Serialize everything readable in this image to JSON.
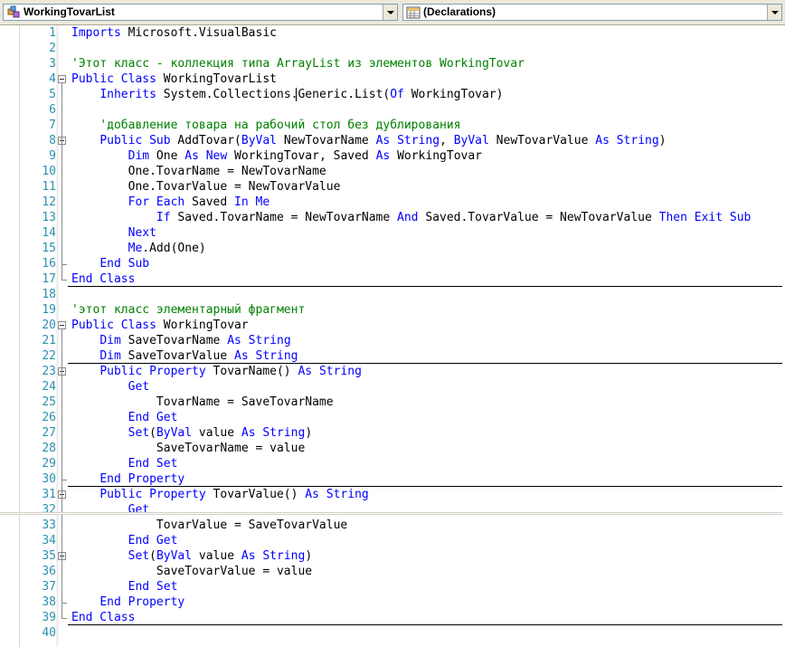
{
  "navigation": {
    "class_selector": "WorkingTovarList",
    "member_selector": "(Declarations)"
  },
  "code": {
    "lines": [
      {
        "n": "1",
        "tokens": [
          {
            "t": "Imports",
            "c": "kw"
          },
          {
            "t": " Microsoft.VisualBasic"
          }
        ]
      },
      {
        "n": "2",
        "tokens": []
      },
      {
        "n": "3",
        "tokens": [
          {
            "t": "'Этот класс - коллекция типа ArrayList из элементов WorkingTovar",
            "c": "cm"
          }
        ]
      },
      {
        "n": "4",
        "tokens": [
          {
            "t": "Public Class",
            "c": "kw"
          },
          {
            "t": " WorkingTovarList"
          }
        ]
      },
      {
        "n": "5",
        "tokens": [
          {
            "t": "    "
          },
          {
            "t": "Inherits",
            "c": "kw"
          },
          {
            "t": " System.Collections.Generic.List("
          },
          {
            "t": "Of",
            "c": "kw"
          },
          {
            "t": " WorkingTovar)"
          }
        ]
      },
      {
        "n": "6",
        "tokens": []
      },
      {
        "n": "7",
        "tokens": [
          {
            "t": "    "
          },
          {
            "t": "'добавление товара на рабочий стол без дублирования",
            "c": "cm"
          }
        ]
      },
      {
        "n": "8",
        "tokens": [
          {
            "t": "    "
          },
          {
            "t": "Public Sub",
            "c": "kw"
          },
          {
            "t": " AddTovar("
          },
          {
            "t": "ByVal",
            "c": "kw"
          },
          {
            "t": " NewTovarName "
          },
          {
            "t": "As String",
            "c": "kw"
          },
          {
            "t": ", "
          },
          {
            "t": "ByVal",
            "c": "kw"
          },
          {
            "t": " NewTovarValue "
          },
          {
            "t": "As String",
            "c": "kw"
          },
          {
            "t": ")"
          }
        ]
      },
      {
        "n": "9",
        "tokens": [
          {
            "t": "        "
          },
          {
            "t": "Dim",
            "c": "kw"
          },
          {
            "t": " One "
          },
          {
            "t": "As New",
            "c": "kw"
          },
          {
            "t": " WorkingTovar, Saved "
          },
          {
            "t": "As",
            "c": "kw"
          },
          {
            "t": " WorkingTovar"
          }
        ]
      },
      {
        "n": "10",
        "tokens": [
          {
            "t": "        One.TovarName = NewTovarName"
          }
        ]
      },
      {
        "n": "11",
        "tokens": [
          {
            "t": "        One.TovarValue = NewTovarValue"
          }
        ]
      },
      {
        "n": "12",
        "tokens": [
          {
            "t": "        "
          },
          {
            "t": "For Each",
            "c": "kw"
          },
          {
            "t": " Saved "
          },
          {
            "t": "In Me",
            "c": "kw"
          }
        ]
      },
      {
        "n": "13",
        "tokens": [
          {
            "t": "            "
          },
          {
            "t": "If",
            "c": "kw"
          },
          {
            "t": " Saved.TovarName = NewTovarName "
          },
          {
            "t": "And",
            "c": "kw"
          },
          {
            "t": " Saved.TovarValue = NewTovarValue "
          },
          {
            "t": "Then Exit Sub",
            "c": "kw"
          }
        ]
      },
      {
        "n": "14",
        "tokens": [
          {
            "t": "        "
          },
          {
            "t": "Next",
            "c": "kw"
          }
        ]
      },
      {
        "n": "15",
        "tokens": [
          {
            "t": "        "
          },
          {
            "t": "Me",
            "c": "kw"
          },
          {
            "t": ".Add(One)"
          }
        ]
      },
      {
        "n": "16",
        "tokens": [
          {
            "t": "    "
          },
          {
            "t": "End Sub",
            "c": "kw"
          }
        ]
      },
      {
        "n": "17",
        "tokens": [
          {
            "t": "End Class",
            "c": "kw"
          }
        ]
      },
      {
        "n": "18",
        "tokens": []
      },
      {
        "n": "19",
        "tokens": [
          {
            "t": "'этот класс элементарный фрагмент",
            "c": "cm"
          }
        ]
      },
      {
        "n": "20",
        "tokens": [
          {
            "t": "Public Class",
            "c": "kw"
          },
          {
            "t": " WorkingTovar"
          }
        ]
      },
      {
        "n": "21",
        "tokens": [
          {
            "t": "    "
          },
          {
            "t": "Dim",
            "c": "kw"
          },
          {
            "t": " SaveTovarName "
          },
          {
            "t": "As String",
            "c": "kw"
          }
        ]
      },
      {
        "n": "22",
        "tokens": [
          {
            "t": "    "
          },
          {
            "t": "Dim",
            "c": "kw"
          },
          {
            "t": " SaveTovarValue "
          },
          {
            "t": "As String",
            "c": "kw"
          }
        ]
      },
      {
        "n": "23",
        "tokens": [
          {
            "t": "    "
          },
          {
            "t": "Public Property",
            "c": "kw"
          },
          {
            "t": " TovarName() "
          },
          {
            "t": "As String",
            "c": "kw"
          }
        ]
      },
      {
        "n": "24",
        "tokens": [
          {
            "t": "        "
          },
          {
            "t": "Get",
            "c": "kw"
          }
        ]
      },
      {
        "n": "25",
        "tokens": [
          {
            "t": "            TovarName = SaveTovarName"
          }
        ]
      },
      {
        "n": "26",
        "tokens": [
          {
            "t": "        "
          },
          {
            "t": "End Get",
            "c": "kw"
          }
        ]
      },
      {
        "n": "27",
        "tokens": [
          {
            "t": "        "
          },
          {
            "t": "Set",
            "c": "kw"
          },
          {
            "t": "("
          },
          {
            "t": "ByVal",
            "c": "kw"
          },
          {
            "t": " value "
          },
          {
            "t": "As String",
            "c": "kw"
          },
          {
            "t": ")"
          }
        ]
      },
      {
        "n": "28",
        "tokens": [
          {
            "t": "            SaveTovarName = value"
          }
        ]
      },
      {
        "n": "29",
        "tokens": [
          {
            "t": "        "
          },
          {
            "t": "End Set",
            "c": "kw"
          }
        ]
      },
      {
        "n": "30",
        "tokens": [
          {
            "t": "    "
          },
          {
            "t": "End Property",
            "c": "kw"
          }
        ]
      },
      {
        "n": "31",
        "tokens": [
          {
            "t": "    "
          },
          {
            "t": "Public Property",
            "c": "kw"
          },
          {
            "t": " TovarValue() "
          },
          {
            "t": "As String",
            "c": "kw"
          }
        ]
      },
      {
        "n": "32",
        "tokens": [
          {
            "t": "        "
          },
          {
            "t": "Get",
            "c": "kw"
          }
        ]
      },
      {
        "n": "33",
        "tokens": [
          {
            "t": "            TovarValue = SaveTovarValue"
          }
        ]
      },
      {
        "n": "34",
        "tokens": [
          {
            "t": "        "
          },
          {
            "t": "End Get",
            "c": "kw"
          }
        ]
      },
      {
        "n": "35",
        "tokens": [
          {
            "t": "        "
          },
          {
            "t": "Set",
            "c": "kw"
          },
          {
            "t": "("
          },
          {
            "t": "ByVal",
            "c": "kw"
          },
          {
            "t": " value "
          },
          {
            "t": "As String",
            "c": "kw"
          },
          {
            "t": ")"
          }
        ]
      },
      {
        "n": "36",
        "tokens": [
          {
            "t": "            SaveTovarValue = value"
          }
        ]
      },
      {
        "n": "37",
        "tokens": [
          {
            "t": "        "
          },
          {
            "t": "End Set",
            "c": "kw"
          }
        ]
      },
      {
        "n": "38",
        "tokens": [
          {
            "t": "    "
          },
          {
            "t": "End Property",
            "c": "kw"
          }
        ]
      },
      {
        "n": "39",
        "tokens": [
          {
            "t": "End Class",
            "c": "kw"
          }
        ]
      },
      {
        "n": "40",
        "tokens": []
      }
    ],
    "collapsible_lines": [
      "4",
      "8",
      "20",
      "23",
      "31",
      "35"
    ],
    "separator_after_lines": [
      "17",
      "22",
      "30",
      "39"
    ]
  },
  "colors": {
    "keyword": "#0000ff",
    "comment": "#008000",
    "line_number": "#2b91af",
    "text": "#000000"
  }
}
